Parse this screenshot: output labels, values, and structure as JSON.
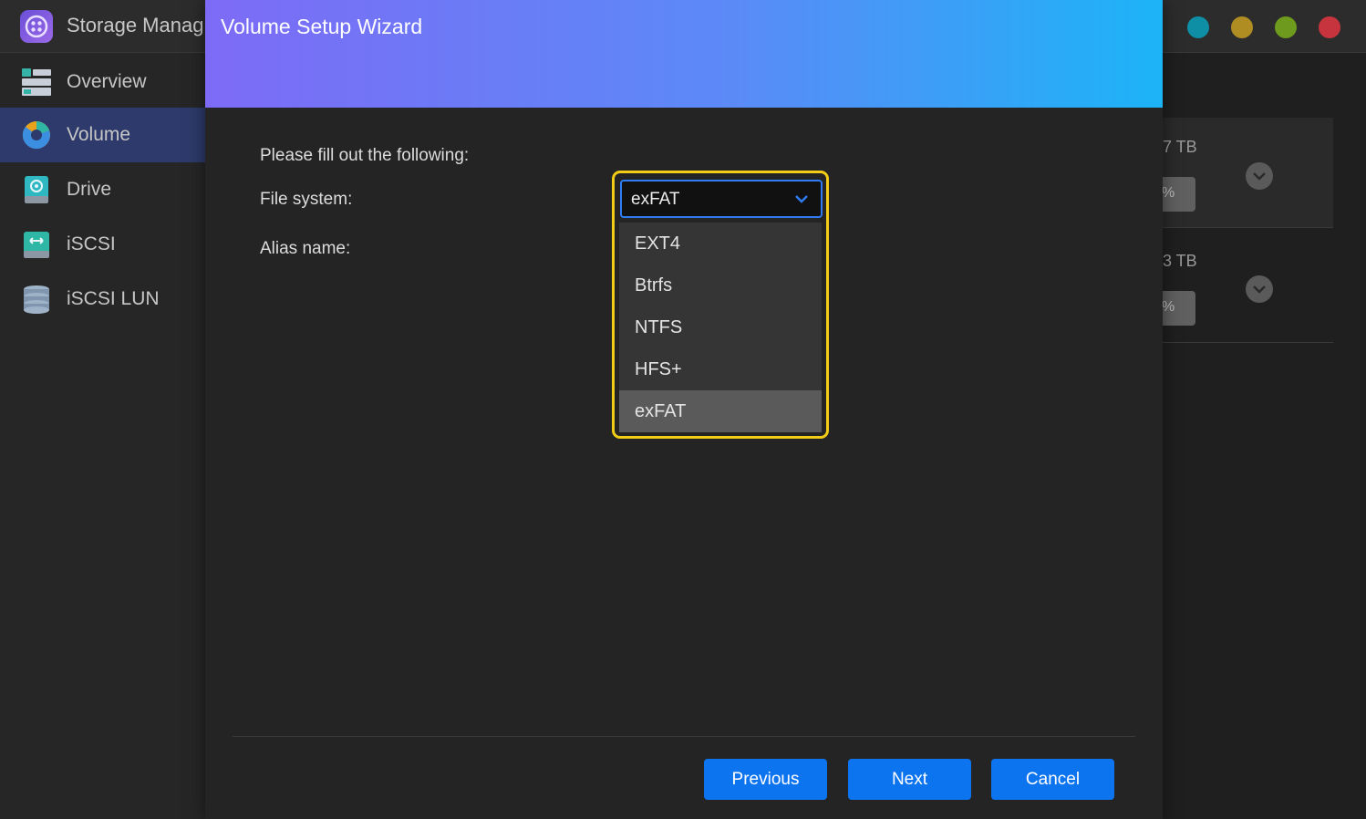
{
  "app": {
    "title": "Storage Manag",
    "window_controls": [
      {
        "name": "teal-dot",
        "color": "#0e8fa6"
      },
      {
        "name": "yellow-dot",
        "color": "#b08d22"
      },
      {
        "name": "green-dot",
        "color": "#6e9a1e"
      },
      {
        "name": "red-dot",
        "color": "#c8343d"
      }
    ]
  },
  "sidebar": {
    "items": [
      {
        "label": "Overview",
        "icon": "overview-icon",
        "active": false
      },
      {
        "label": "Volume",
        "icon": "volume-pie-icon",
        "active": true
      },
      {
        "label": "Drive",
        "icon": "drive-icon",
        "active": false
      },
      {
        "label": "iSCSI",
        "icon": "iscsi-icon",
        "active": false
      },
      {
        "label": "iSCSI LUN",
        "icon": "iscsi-lun-icon",
        "active": false
      }
    ]
  },
  "background": {
    "cards": [
      {
        "size": "7 TB",
        "pill": "%"
      },
      {
        "size": "3 TB",
        "pill": "%"
      }
    ]
  },
  "wizard": {
    "title": "Volume Setup Wizard",
    "intro": "Please fill out the following:",
    "file_system_label": "File system:",
    "alias_label": "Alias name:",
    "file_system_selected": "exFAT",
    "options": [
      "EXT4",
      "Btrfs",
      "NTFS",
      "HFS+",
      "exFAT"
    ],
    "buttons": {
      "previous": "Previous",
      "next": "Next",
      "cancel": "Cancel"
    }
  },
  "colors": {
    "accent": "#0d74f0",
    "highlight": "#f2cc16",
    "header_gradient_start": "#7d6bf6",
    "header_gradient_end": "#1cb4f7"
  }
}
